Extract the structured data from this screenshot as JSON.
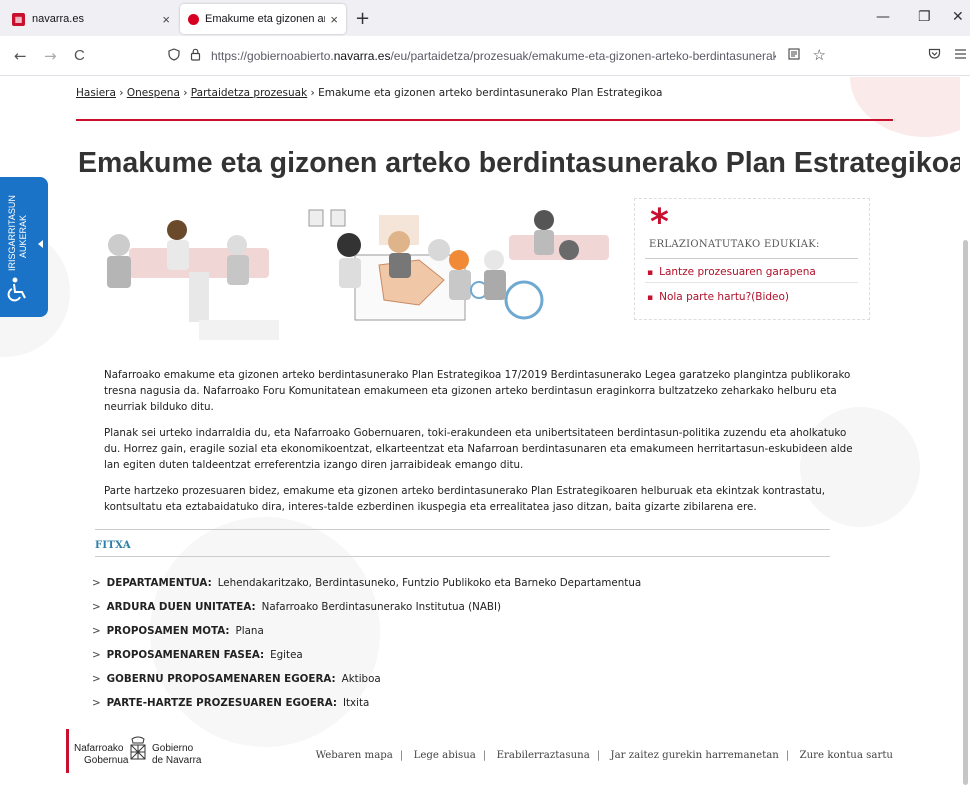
{
  "browser": {
    "tabs": [
      {
        "label": "navarra.es",
        "close": "×"
      },
      {
        "label": "Emakume eta gizonen arteko berdintasunerako",
        "close": "×"
      }
    ],
    "new_tab": "+",
    "window_controls": {
      "minimize": "—",
      "maximize": "❐",
      "close": "✕"
    },
    "back": "←",
    "forward": "→",
    "reload": "C",
    "url_prefix": "https://gobiernoabierto.",
    "url_domain": "navarra.es",
    "url_suffix": "/eu/partaidetza/prozesuak/emakume-eta-gizonen-arteko-berdintasunerako-plan-estrategikoa"
  },
  "breadcrumb": {
    "items": [
      "Hasiera",
      "Onespena",
      "Partaidetza prozesuak"
    ],
    "separator": "›",
    "current": "Emakume eta gizonen arteko berdintasunerako Plan Estrategikoa"
  },
  "page_title": "Emakume eta gizonen arteko berdintasunerako Plan Estrategikoa",
  "related": {
    "heading": "ERLAZIONATUTAKO EDUKIAK:",
    "items": [
      "Lantze prozesuaren garapena",
      "Nola parte hartu?(Bideo)"
    ]
  },
  "body": {
    "paragraphs": [
      "Nafarroako emakume eta gizonen arteko berdintasunerako Plan Estrategikoa 17/2019 Berdintasunerako Legea garatzeko plangintza publikorako tresna nagusia da. Nafarroako Foru Komunitatean emakumeen eta gizonen arteko berdintasun eraginkorra bultzatzeko zeharkako helburu eta neurriak bilduko ditu.",
      "Planak sei urteko indarraldia du, eta Nafarroako Gobernuaren, toki-erakundeen eta unibertsitateen berdintasun-politika zuzendu eta aholkatuko du. Horrez gain, eragile sozial eta ekonomikoentzat, elkarteentzat eta Nafarroan berdintasunaren eta emakumeen herritartasun-eskubideen alde lan egiten duten taldeentzat erreferentzia izango diren jarraibideak emango ditu.",
      "Parte hartzeko prozesuaren bidez, emakume eta gizonen arteko berdintasunerako Plan Estrategikoaren helburuak eta ekintzak kontrastatu, kontsultatu eta eztabaidatuko dira, interes-talde ezberdinen ikuspegia eta errealitatea jaso ditzan, baita gizarte zibilarena ere."
    ]
  },
  "fitxa": {
    "heading": "FITXA",
    "rows": [
      {
        "key": "DEPARTAMENTUA:",
        "value": "Lehendakaritzako, Berdintasuneko, Funtzio Publikoko eta Barneko Departamentua"
      },
      {
        "key": "ARDURA DUEN UNITATEA:",
        "value": "Nafarroako Berdintasunerako Institutua (NABI)"
      },
      {
        "key": "PROPOSAMEN MOTA:",
        "value": "Plana"
      },
      {
        "key": "PROPOSAMENAREN FASEA:",
        "value": "Egitea"
      },
      {
        "key": "GOBERNU PROPOSAMENAREN EGOERA:",
        "value": "Aktiboa"
      },
      {
        "key": "PARTE-HARTZE PROZESUAREN EGOERA:",
        "value": "Itxita"
      }
    ]
  },
  "footer": {
    "logo_left_1": "Nafarroako",
    "logo_left_2": "Gobernua",
    "logo_right_1": "Gobierno",
    "logo_right_2": "de Navarra",
    "links": [
      "Webaren mapa",
      "Lege abisua",
      "Erabilerraztasuna",
      "Jar zaitez gurekin harremanetan",
      "Zure kontua sartu"
    ]
  },
  "accessibility_tab": {
    "line1": "IRISGARRITASUN",
    "line2": "AUKERAK"
  },
  "colors": {
    "brand_red": "#c8102e",
    "link_red": "#b0102a",
    "fitxa_blue": "#2e7fa5",
    "accessibility_blue": "#1a73c6"
  },
  "icons": [
    "table-favicon",
    "record-favicon",
    "shield-icon",
    "lock-icon",
    "reader-view-icon",
    "bookmark-star-icon",
    "pocket-icon",
    "menu-icon",
    "wheelchair-icon",
    "asterisk-icon"
  ]
}
